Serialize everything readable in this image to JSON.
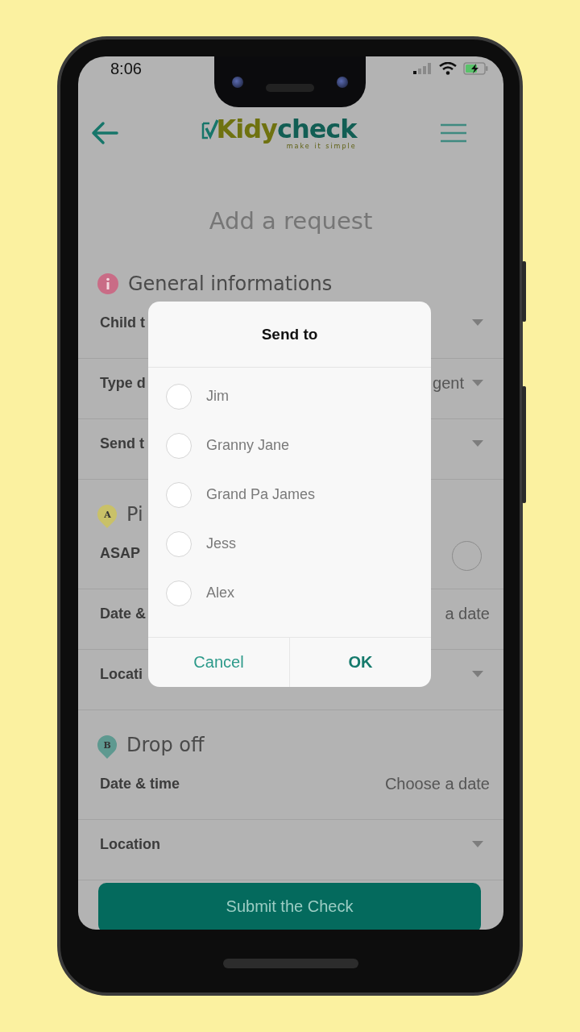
{
  "status_bar": {
    "time": "8:06"
  },
  "header": {
    "logo": {
      "part1": "Kidy",
      "part2": "check",
      "tagline": "make it simple"
    }
  },
  "title": "Add a request",
  "sections": [
    {
      "kind": "info",
      "title": "General informations",
      "rows": [
        {
          "kind": "select",
          "label": "Child t"
        },
        {
          "kind": "select",
          "label": "Type d",
          "value": "gent"
        },
        {
          "kind": "select",
          "label": "Send t"
        }
      ]
    },
    {
      "kind": "pin",
      "letter": "A",
      "color": "#c9c168",
      "title": "Pi",
      "rows": [
        {
          "kind": "toggle",
          "label": "ASAP",
          "checked": false
        },
        {
          "kind": "date",
          "label": "Date &",
          "value": "a date"
        },
        {
          "kind": "select",
          "label": "Locati"
        }
      ]
    },
    {
      "kind": "pin",
      "letter": "B",
      "color": "#5e9990",
      "title": "Drop off",
      "rows": [
        {
          "kind": "date",
          "label": "Date & time",
          "value": "Choose a date"
        },
        {
          "kind": "select",
          "label": "Location"
        }
      ]
    }
  ],
  "submit_button": "Submit the Check",
  "dialog": {
    "title": "Send to",
    "options": [
      {
        "label": "Jim",
        "selected": false
      },
      {
        "label": "Granny Jane",
        "selected": false
      },
      {
        "label": "Grand Pa James",
        "selected": false
      },
      {
        "label": "Jess",
        "selected": false
      },
      {
        "label": "Alex",
        "selected": false
      }
    ],
    "cancel": "Cancel",
    "ok": "OK"
  }
}
